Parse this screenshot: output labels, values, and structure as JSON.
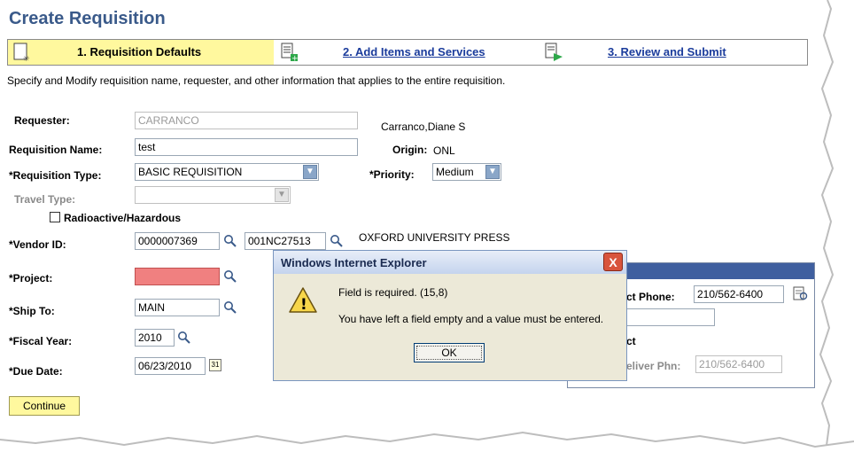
{
  "page": {
    "title": "Create Requisition"
  },
  "steps": [
    {
      "label": "1. Requisition Defaults"
    },
    {
      "label": "2. Add Items and Services"
    },
    {
      "label": "3. Review and Submit"
    }
  ],
  "instructions": "Specify and Modify requisition name, requester, and other information that applies to the entire requisition.",
  "form": {
    "requester_label": "Requester:",
    "requester_value": "CARRANCO",
    "requester_name": "Carranco,Diane S",
    "req_name_label": "Requisition Name:",
    "req_name_value": "test",
    "origin_label": "Origin:",
    "origin_value": "ONL",
    "req_type_label": "*Requisition Type:",
    "req_type_value": "BASIC REQUISITION",
    "priority_label": "*Priority:",
    "priority_value": "Medium",
    "travel_label": "Travel Type:",
    "radioactive_label": "Radioactive/Hazardous",
    "vendor_label": "*Vendor ID:",
    "vendor_id": "0000007369",
    "vendor_loc": "001NC27513",
    "vendor_name": "OXFORD UNIVERSITY PRESS",
    "project_label": "*Project:",
    "ship_label": "*Ship To:",
    "ship_value": "MAIN",
    "fiscal_label": "*Fiscal Year:",
    "fiscal_value": "2010",
    "due_label": "*Due Date:",
    "due_value": "06/23/2010",
    "continue_label": "Continue"
  },
  "panel": {
    "phone_label": "ct Phone:",
    "phone_value": "210/562-6400",
    "ct_label": "ct",
    "deliver_label": "eliver Phn:",
    "deliver_value": "210/562-6400"
  },
  "dialog": {
    "title": "Windows Internet Explorer",
    "close": "X",
    "line1": "Field is required. (15,8)",
    "line2": "You have left a field empty and a value must be entered.",
    "ok": "OK"
  },
  "icons": {
    "warning": "!",
    "calendar": "31",
    "dropdown": "▼"
  },
  "colors": {
    "step_active": "#fff89e",
    "required_field": "#f08080",
    "title": "#3a5a8a",
    "link": "#1b3c9c"
  }
}
